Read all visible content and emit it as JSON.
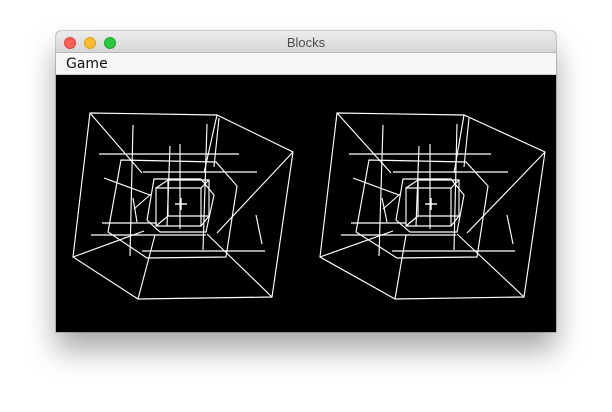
{
  "window": {
    "title": "Blocks"
  },
  "menu": {
    "items": [
      {
        "label": "Game"
      }
    ]
  },
  "viewport": {
    "mode": "stereo",
    "views": [
      "left-eye",
      "right-eye"
    ],
    "wire_color": "#ffffff",
    "background_color": "#000000"
  },
  "colors": {
    "close": "#ff5f57",
    "minimize": "#febc2e",
    "zoom": "#28c840"
  }
}
